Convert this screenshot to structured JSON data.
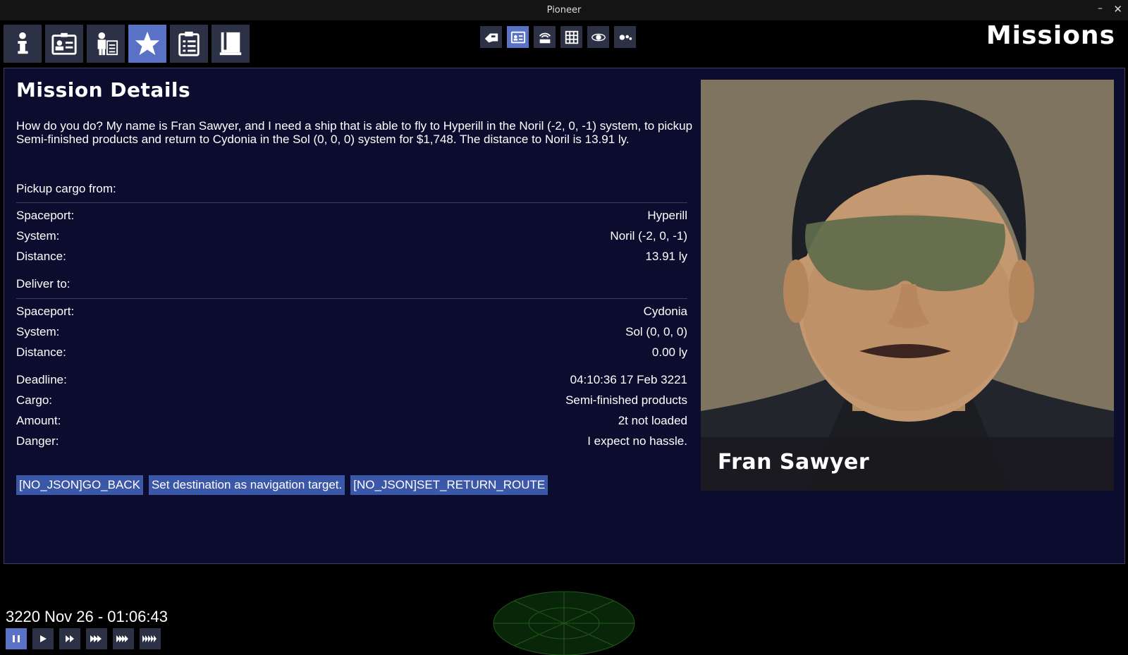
{
  "window": {
    "title": "Pioneer",
    "minimize": "–",
    "close": "✕"
  },
  "tabs": [
    {
      "icon": "info-icon",
      "active": false
    },
    {
      "icon": "id-card-icon",
      "active": false
    },
    {
      "icon": "crew-icon",
      "active": false
    },
    {
      "icon": "star-icon",
      "active": true
    },
    {
      "icon": "clipboard-icon",
      "active": false
    },
    {
      "icon": "book-icon",
      "active": false
    }
  ],
  "tools": [
    {
      "icon": "ship-icon"
    },
    {
      "icon": "id-card-icon",
      "active": true
    },
    {
      "icon": "comms-icon"
    },
    {
      "icon": "grid-icon"
    },
    {
      "icon": "orbit-icon"
    },
    {
      "icon": "people-icon"
    }
  ],
  "view_title": "Missions",
  "mission": {
    "heading": "Mission Details",
    "description": "How do you do? My name is Fran Sawyer, and I need a ship that is able to fly to Hyperill in the Noril (-2, 0, -1) system, to pickup Semi-finished products and return to Cydonia in the Sol (0, 0, 0) system for $1,748. The distance to Noril is 13.91 ly.",
    "pickup_label": "Pickup cargo from:",
    "pickup": [
      {
        "key": "Spaceport:",
        "value": "Hyperill"
      },
      {
        "key": "System:",
        "value": "Noril (-2, 0, -1)"
      },
      {
        "key": "Distance:",
        "value": "13.91 ly"
      }
    ],
    "deliver_label": "Deliver to:",
    "deliver": [
      {
        "key": "Spaceport:",
        "value": "Cydonia"
      },
      {
        "key": "System:",
        "value": "Sol (0, 0, 0)"
      },
      {
        "key": "Distance:",
        "value": "0.00 ly"
      }
    ],
    "details": [
      {
        "key": "Deadline:",
        "value": "04:10:36 17 Feb 3221"
      },
      {
        "key": "Cargo:",
        "value": "Semi-finished products"
      },
      {
        "key": "Amount:",
        "value": "2t not loaded"
      },
      {
        "key": "Danger:",
        "value": "I expect no hassle."
      }
    ],
    "buttons": {
      "back": "[NO_JSON]GO_BACK",
      "set_destination": "Set destination as navigation target.",
      "return_route": "[NO_JSON]SET_RETURN_ROUTE"
    },
    "client_name": "Fran Sawyer"
  },
  "status": {
    "date": "3220 Nov 26 - 01:06:43",
    "speeds": [
      "pause",
      "play",
      "fast-1",
      "fast-2",
      "fast-3",
      "fast-4"
    ],
    "active_speed": "pause"
  },
  "colors": {
    "accent": "#5a72c6",
    "panel": "#0c0d2e",
    "button": "#3a57a8"
  }
}
